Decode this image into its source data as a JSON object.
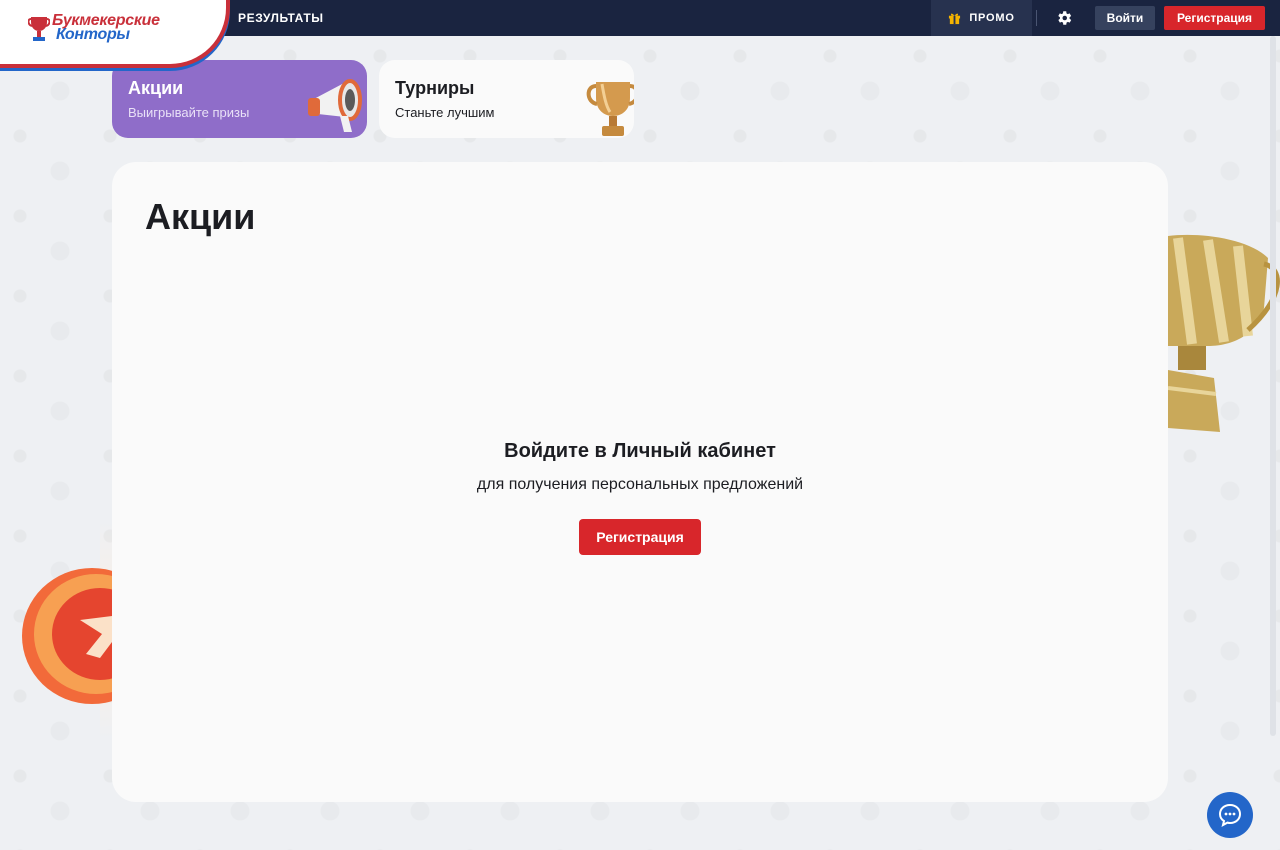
{
  "header": {
    "logo": {
      "line1": "Букмекерские",
      "line2": "Конторы"
    },
    "nav_results": "РЕЗУЛЬТАТЫ",
    "promo_label": "ПРОМО",
    "promo_icon": "gift-icon",
    "settings_icon": "gear-icon",
    "login_label": "Войти",
    "register_label": "Регистрация"
  },
  "categories": [
    {
      "title": "Акции",
      "subtitle": "Выигрывайте призы",
      "icon": "megaphone-icon",
      "active": true
    },
    {
      "title": "Турниры",
      "subtitle": "Станьте лучшим",
      "icon": "trophy-icon",
      "active": false
    }
  ],
  "main": {
    "title": "Акции",
    "login_prompt_title": "Войдите в Личный кабинет",
    "login_prompt_subtitle": "для получения персональных предложений",
    "register_label": "Регистрация"
  },
  "chat_icon": "chat-icon",
  "colors": {
    "topbar": "#1a2440",
    "accent_red": "#d8262b",
    "accent_blue": "#2366c9",
    "active_card": "#8f6dc9"
  }
}
